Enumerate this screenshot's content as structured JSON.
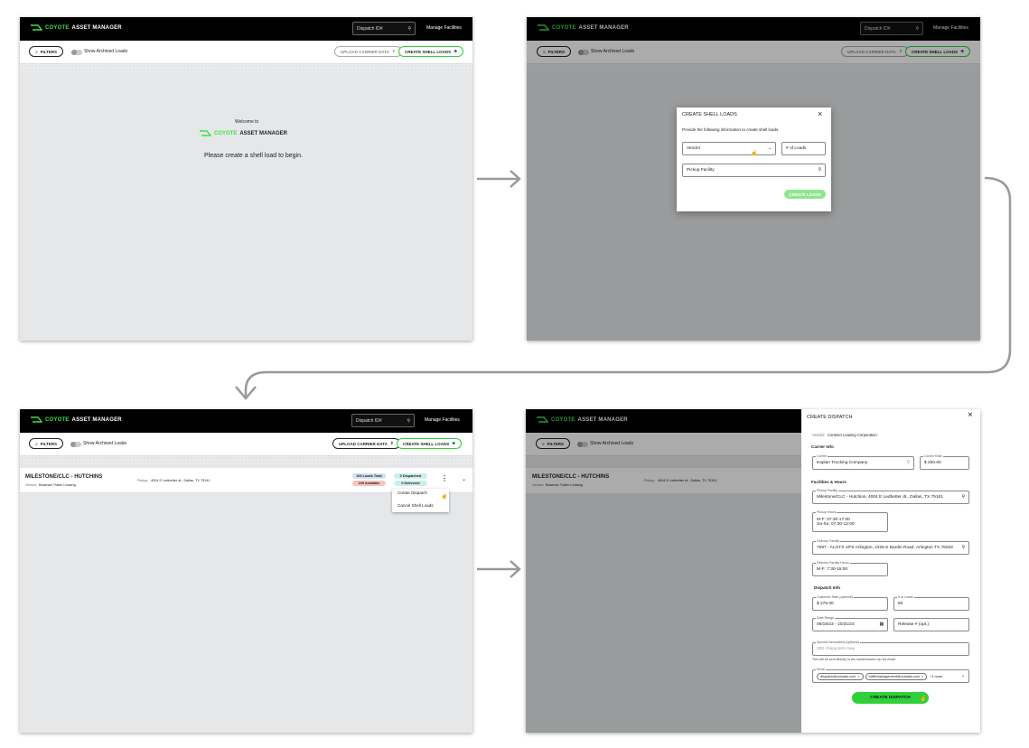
{
  "brand": {
    "name_green": "COYOTE",
    "name_white": "ASSET MANAGER",
    "welcome": "Welcome to",
    "prompt": "Please create a shell load to begin."
  },
  "header": {
    "search_placeholder": "Dispatch ID#",
    "manage": "Manage Facilities"
  },
  "toolbar": {
    "filters": "FILTERS",
    "archived": "Show Archived Loads",
    "upload": "UPLOAD CARRIER DATA",
    "create_shell": "CREATE SHELL LOADS"
  },
  "shell_modal": {
    "title": "CREATE SHELL LOADS",
    "instructions": "Provide the following information to create shell loads.",
    "vendor_placeholder": "Vendor",
    "loads_placeholder": "# of Loads",
    "pickup_placeholder": "Pickup Facility",
    "submit": "CREATE LOADS"
  },
  "load_row": {
    "title": "MILESTONE/CLC - HUTCHINS",
    "vendor_label": "Vendor:",
    "vendor": "Bowman Trailer Leasing",
    "pickup_label": "Pickup:",
    "pickup": "4004 E Ledbetter dr., Dallas, TX 75141",
    "total": "100 Loads Total",
    "available": "100 Available",
    "dispatched": "0 Dispatched",
    "delivered": "0 Delivered"
  },
  "row_menu": {
    "create": "Create Dispatch",
    "cancel": "Cancel Shell Loads"
  },
  "dispatch": {
    "title": "CREATE DISPATCH",
    "vendor_label": "Vendor:",
    "vendor": "Contract Leasing Corporation",
    "carrier_section": "Carrier Info",
    "carrier_label": "Carrier",
    "carrier": "Kaplan Trucking Company",
    "rate_label": "Carrier Rate",
    "rate": "$ 250.00",
    "fac_section": "Facilities & Hours",
    "pickup_label": "Pickup Facility",
    "pickup": "Milestone/CLC - Hutchins, 4004 E Ledbetter dr., Dallas, TX 75161",
    "pickup_hours_label": "Pickup Hours",
    "pickup_hours_1": "M-F: 07:30-17:00",
    "pickup_hours_2": "Sa-Su: 07:30-12:00",
    "delivery_label": "Delivery Facility",
    "delivery": "7597 - ALGTX UPS Arlington, 2325 E Bardin Road, Arlington TX 76018",
    "delivery_hours_label": "Delivery Facility Hours",
    "delivery_hours": "M-F: 7:30-15:00",
    "dispatch_section": "Dispatch Info",
    "cust_rate_label": "Customer Rate (optional)",
    "cust_rate": "$ 275.00",
    "loads_label": "# of Loads",
    "loads": "50",
    "date_label": "Date Range",
    "date": "09/15/23 - 10/31/23",
    "release_placeholder": "Release # (opt.)",
    "instr_label": "Special Instructions (optional)",
    "instr_placeholder": "200 characters max",
    "instr_note": "This will be sent directly to the carrier/carrier rep via email.",
    "email_label": "Email",
    "email_1": "dispatch@coloads.com",
    "email_2": "trafficmanagement@coloads.com",
    "email_more": "+1 more",
    "submit": "CREATE DISPATCH"
  },
  "colors": {
    "accent": "#3ee043",
    "black": "#000000",
    "bg": "#e6e7e9"
  }
}
